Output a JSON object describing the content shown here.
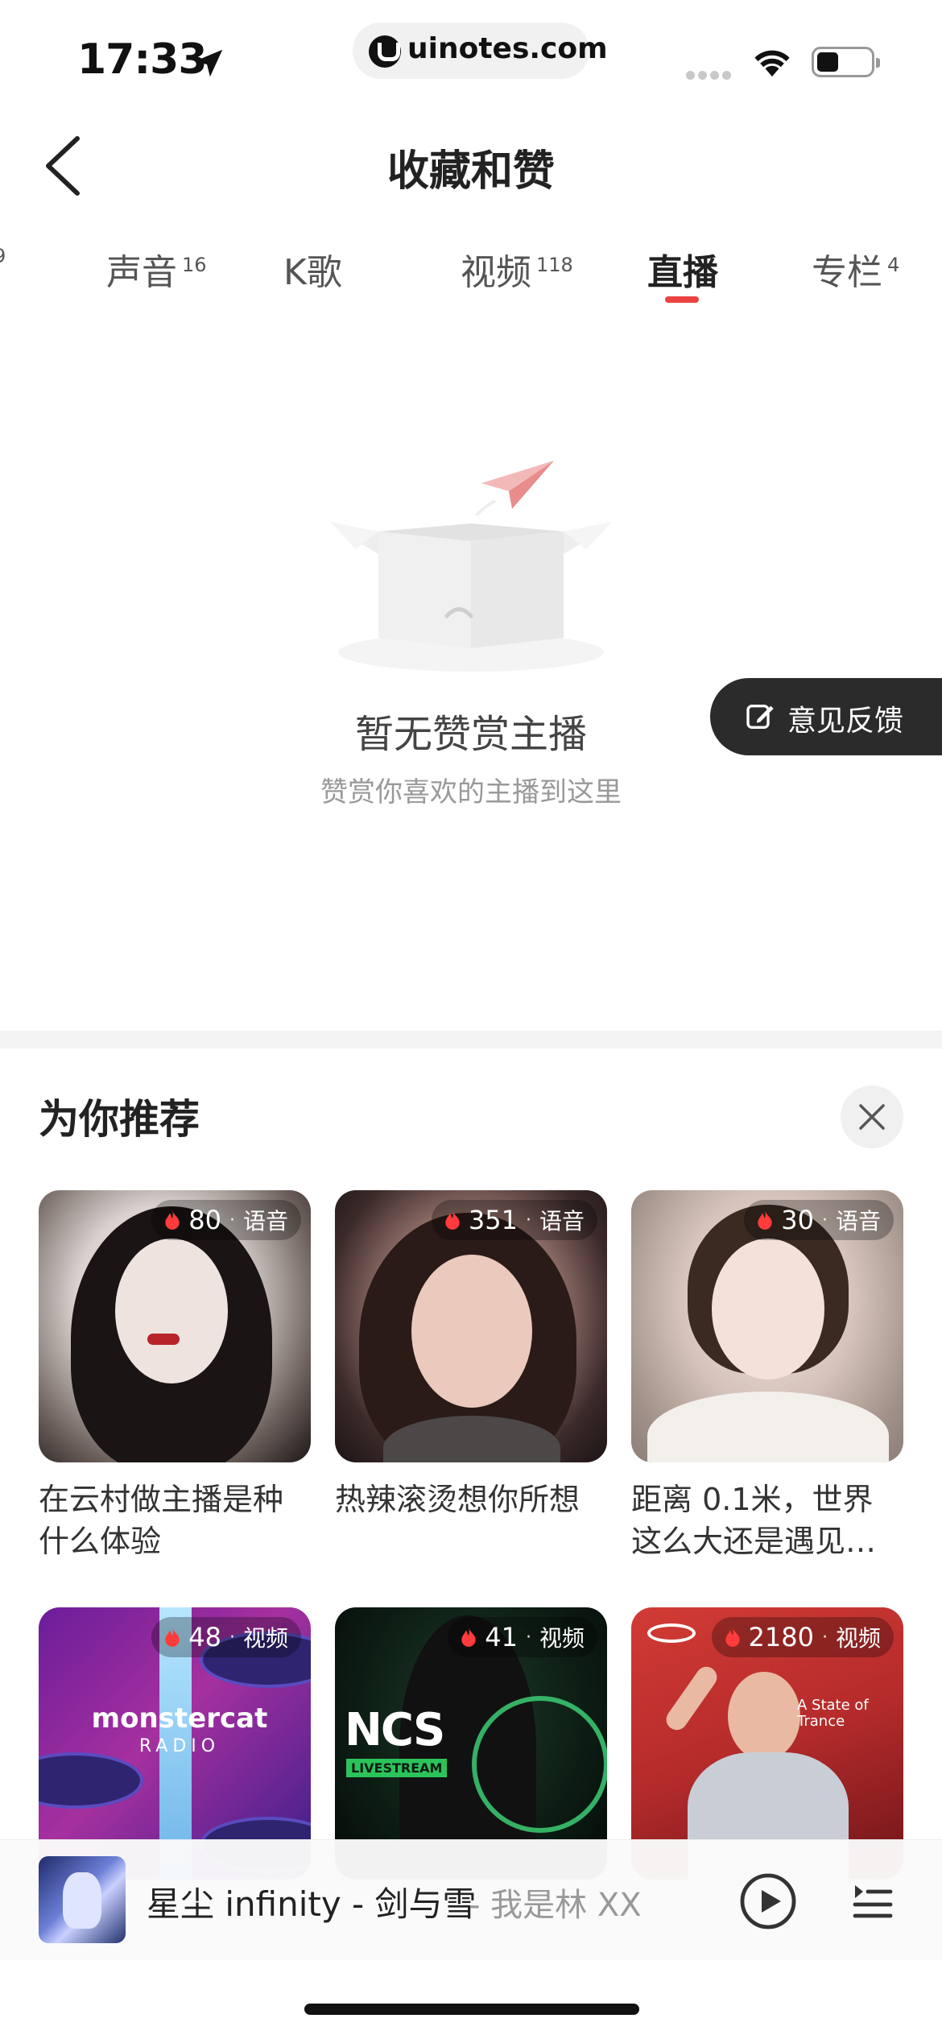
{
  "status_bar": {
    "time": "17:33",
    "url": "uinotes.com",
    "icons": [
      "location-arrow-icon",
      "signal-icon",
      "wifi-icon",
      "battery-icon"
    ]
  },
  "header": {
    "back_icon": "back-arrow-icon",
    "title": "收藏和赞"
  },
  "tabs": [
    {
      "label": "",
      "count": "9",
      "active": false
    },
    {
      "label": "声音",
      "count": "16",
      "active": false
    },
    {
      "label": "K歌",
      "count": "",
      "active": false
    },
    {
      "label": "视频",
      "count": "118",
      "active": false
    },
    {
      "label": "直播",
      "count": "",
      "active": true
    },
    {
      "label": "专栏",
      "count": "4",
      "active": false
    }
  ],
  "empty_state": {
    "title": "暂无赞赏主播",
    "subtitle": "赞赏你喜欢的主播到这里",
    "icon": "empty-box-icon"
  },
  "feedback": {
    "label": "意见反馈",
    "icon": "edit-icon"
  },
  "recommend": {
    "title": "为你推荐",
    "close_icon": "close-icon",
    "cards": [
      {
        "count": "80",
        "kind": "语音",
        "title": "在云村做主播是种什么体验"
      },
      {
        "count": "351",
        "kind": "语音",
        "title": "热辣滚烫想你所想"
      },
      {
        "count": "30",
        "kind": "语音",
        "title": "距离 0.1米，世界这么大还是遇见…"
      },
      {
        "count": "48",
        "kind": "视频",
        "title": "",
        "art_text": "monstercat",
        "art_sub": "RADIO"
      },
      {
        "count": "41",
        "kind": "视频",
        "title": "",
        "art_text": "NCS",
        "art_sub": "LIVESTREAM"
      },
      {
        "count": "2180",
        "kind": "视频",
        "title": "",
        "art_text": "A State of Trance"
      }
    ]
  },
  "player": {
    "song": "星尘 infinity - 剑与雪",
    "artist": "- 我是林 XX",
    "play_icon": "play-icon",
    "playlist_icon": "playlist-icon"
  },
  "colors": {
    "accent": "#ec4141",
    "feedback_bg": "#2b2b2b",
    "divider": "#f4f4f4"
  }
}
